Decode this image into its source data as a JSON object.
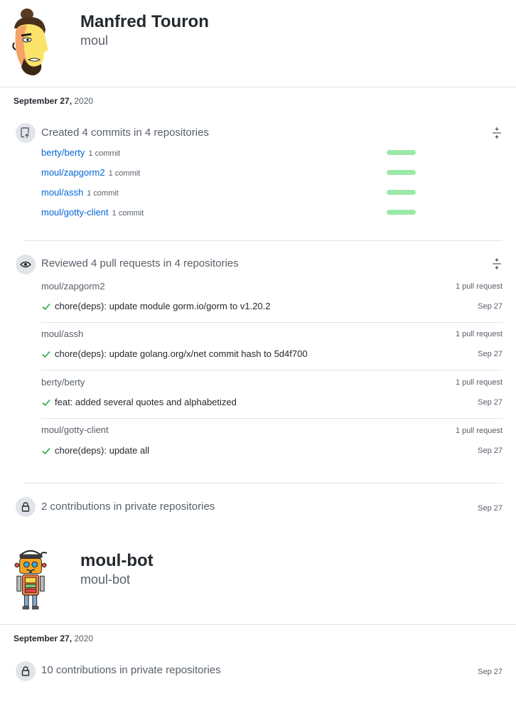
{
  "users": [
    {
      "name": "Manfred Touron",
      "login": "moul"
    },
    {
      "name": "moul-bot",
      "login": "moul-bot"
    }
  ],
  "activity1": {
    "date_month_day": "September 27, ",
    "date_year": "2020",
    "commits": {
      "title": "Created 4 commits in 4 repositories",
      "repos": [
        {
          "name": "berty/berty",
          "count": "1 commit"
        },
        {
          "name": "moul/zapgorm2",
          "count": "1 commit"
        },
        {
          "name": "moul/assh",
          "count": "1 commit"
        },
        {
          "name": "moul/gotty-client",
          "count": "1 commit"
        }
      ]
    },
    "reviews": {
      "title": "Reviewed 4 pull requests in 4 repositories",
      "groups": [
        {
          "repo": "moul/zapgorm2",
          "count": "1 pull request",
          "title": "chore(deps): update module gorm.io/gorm to v1.20.2",
          "date": "Sep 27"
        },
        {
          "repo": "moul/assh",
          "count": "1 pull request",
          "title": "chore(deps): update golang.org/x/net commit hash to 5d4f700",
          "date": "Sep 27"
        },
        {
          "repo": "berty/berty",
          "count": "1 pull request",
          "title": "feat: added several quotes and alphabetized",
          "date": "Sep 27"
        },
        {
          "repo": "moul/gotty-client",
          "count": "1 pull request",
          "title": "chore(deps): update all",
          "date": "Sep 27"
        }
      ]
    },
    "private": {
      "text": "2 contributions in private repositories",
      "date": "Sep 27"
    }
  },
  "activity2": {
    "date_month_day": "September 27, ",
    "date_year": "2020",
    "private": {
      "text": "10 contributions in private repositories",
      "date": "Sep 27"
    }
  },
  "colors": {
    "link": "#0366d6",
    "bar": "#9be9a8",
    "check": "#28a745",
    "muted": "#586069"
  }
}
